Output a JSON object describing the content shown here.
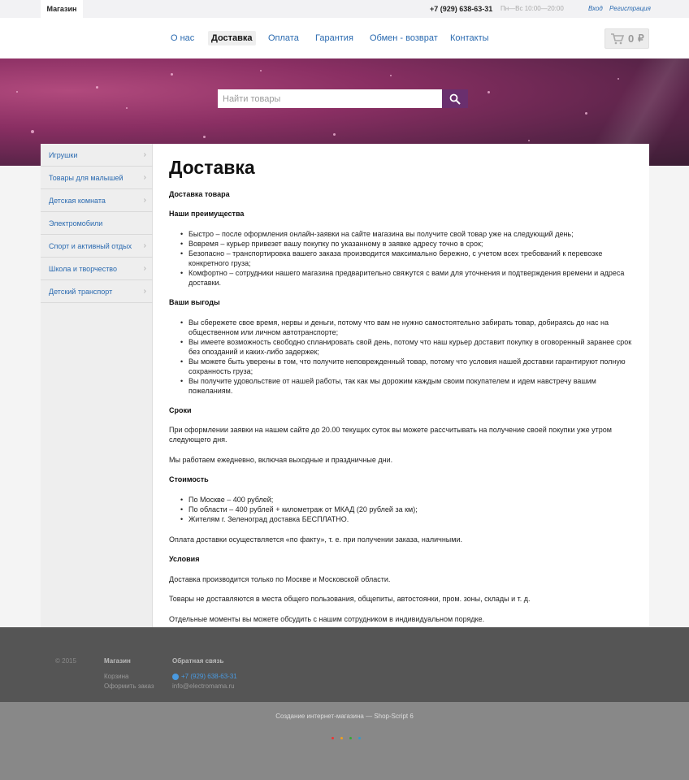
{
  "topbar": {
    "shop_tab": "Магазин",
    "phone": "+7 (929) 638-63-31",
    "hours": "Пн—Вс 10:00—20:00",
    "login": "Вход",
    "register": "Регистрация"
  },
  "nav": {
    "items": [
      "О нас",
      "Доставка",
      "Оплата",
      "Гарантия",
      "Обмен - возврат",
      "Контакты"
    ],
    "active": "Доставка"
  },
  "cart": {
    "count": "0",
    "currency": "₽"
  },
  "search": {
    "placeholder": "Найти товары"
  },
  "sidebar": {
    "items": [
      "Игрушки",
      "Товары для малышей",
      "Детская комната",
      "Электромобили",
      "Спорт и активный отдых",
      "Школа и творчество",
      "Детский транспорт"
    ]
  },
  "content": {
    "title": "Доставка",
    "h_goods": "Доставка товара",
    "h_adv": "Наши преимущества",
    "adv": [
      "Быстро – после оформления онлайн-заявки на сайте магазина вы получите свой товар уже на следующий день;",
      "Вовремя – курьер привезет вашу покупку по указанному в заявке адресу точно в срок;",
      "Безопасно – транспортировка вашего заказа производится максимально бережно, с учетом всех требований к перевозке конкретного груза;",
      "Комфортно – сотрудники нашего магазина предварительно свяжутся с вами для уточнения и подтверждения времени и адреса доставки."
    ],
    "h_benefit": "Ваши выгоды",
    "benefits": [
      "Вы сбережете свое время, нервы и деньги, потому что вам не нужно самостоятельно забирать товар, добираясь до нас на общественном или личном автотранспорте;",
      "Вы имеете возможность свободно спланировать свой день, потому что наш курьер доставит покупку в оговоренный заранее срок без опозданий и каких-либо задержек;",
      "Вы можете быть уверены в том, что получите неповрежденный товар, потому что условия нашей доставки гарантируют полную сохранность груза;",
      "Вы получите удовольствие от нашей работы, так как мы дорожим каждым своим покупателем и идем навстречу вашим пожеланиям."
    ],
    "h_terms": "Сроки",
    "terms_p1": "При оформлении заявки на нашем сайте до 20.00 текущих суток вы можете рассчитывать на получение своей покупки уже утром следующего дня.",
    "terms_p2": "Мы работаем ежедневно, включая выходные и праздничные дни.",
    "h_cost": "Стоимость",
    "costs": [
      "По Москве – 400 рублей;",
      "По области – 400 рублей + километраж от МКАД (20 рублей за км);",
      "Жителям г. Зеленоград доставка БЕСПЛАТНО."
    ],
    "cost_p": "Оплата доставки осуществляется «по факту», т. е. при получении заказа, наличными.",
    "h_cond": "Условия",
    "cond_p1": "Доставка производится только по Москве и Московской области.",
    "cond_p2": "Товары не доставляются в места общего пользования, общепиты, автостоянки, пром. зоны, склады и т. д.",
    "cond_p3": "Отдельные моменты вы можете обсудить с нашим сотрудником в индивидуальном порядке."
  },
  "footer": {
    "copyright": "© 2015",
    "shop_heading": "Магазин",
    "shop_links": [
      "Корзина",
      "Оформить заказ"
    ],
    "feedback_heading": "Обратная связь",
    "phone": "+7 (929) 638-63-31",
    "email": "info@electromama.ru",
    "credit": "Создание интернет-магазина — Shop-Script 6"
  },
  "colors": {
    "accent": "#2a6ab0",
    "banner": "#8a2f63",
    "search_button": "#6a2f6e"
  }
}
